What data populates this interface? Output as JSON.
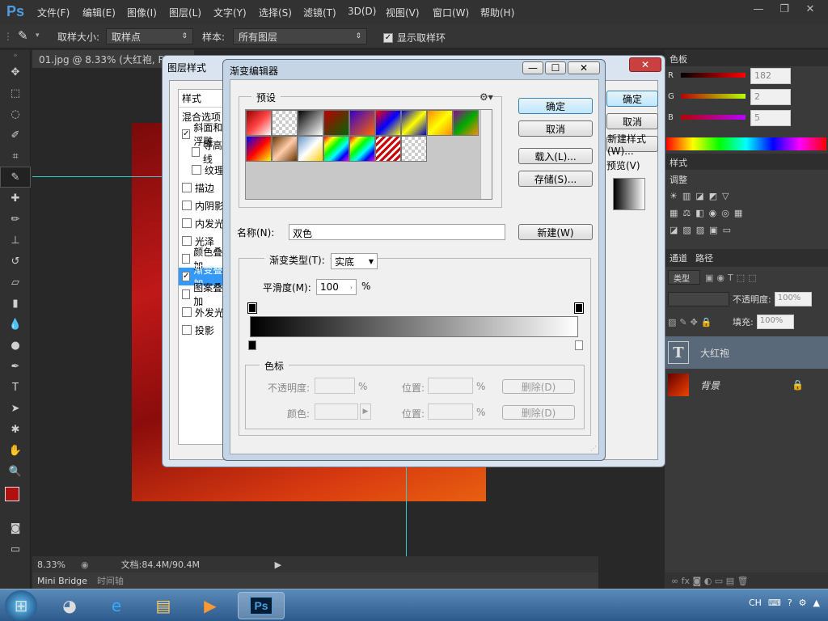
{
  "app": {
    "logo": "Ps"
  },
  "menu": [
    "文件(F)",
    "编辑(E)",
    "图像(I)",
    "图层(L)",
    "文字(Y)",
    "选择(S)",
    "滤镜(T)",
    "3D(D)",
    "视图(V)",
    "窗口(W)",
    "帮助(H)"
  ],
  "options": {
    "sample_size_label": "取样大小:",
    "sample_size_value": "取样点",
    "sample_label": "样本:",
    "sample_value": "所有图层",
    "show_ring_label": "显示取样环"
  },
  "doc_tab": "01.jpg @ 8.33% (大红袍, RG",
  "status": {
    "zoom": "8.33%",
    "doc": "文档:84.4M/90.4M"
  },
  "bottom_tabs": [
    "Mini Bridge",
    "时间轴"
  ],
  "right_panel": {
    "color_tab": "色板",
    "color": {
      "r_label": "R",
      "g_label": "G",
      "b_label": "B",
      "r": "182",
      "g": "2",
      "b": "5"
    },
    "styles_tab": "样式",
    "adjust_label": "调整",
    "channels_tab": "通道",
    "paths_tab": "路径",
    "kind_label": "类型",
    "opacity_label": "不透明度:",
    "opacity": "100%",
    "fill_label": "填充:",
    "fill": "100%",
    "layers": [
      {
        "name": "大红袍"
      },
      {
        "name": "背景"
      }
    ]
  },
  "layer_style": {
    "title": "图层样式",
    "styles_header": "样式",
    "blend_options": "混合选项",
    "items": [
      {
        "label": "斜面和浮雕",
        "checked": true
      },
      {
        "label": "等高线",
        "checked": false
      },
      {
        "label": "纹理",
        "checked": false
      },
      {
        "label": "描边",
        "checked": false
      },
      {
        "label": "内阴影",
        "checked": false
      },
      {
        "label": "内发光",
        "checked": false
      },
      {
        "label": "光泽",
        "checked": false
      },
      {
        "label": "颜色叠加",
        "checked": false
      },
      {
        "label": "渐变叠加",
        "checked": true
      },
      {
        "label": "图案叠加",
        "checked": false
      },
      {
        "label": "外发光",
        "checked": false
      },
      {
        "label": "投影",
        "checked": false
      }
    ],
    "ok_btn": "确定",
    "cancel_btn": "取消",
    "new_style_btn": "新建样式(W)...",
    "preview_label": "预览(V)"
  },
  "gradient_editor": {
    "title": "渐变编辑器",
    "presets_label": "预设",
    "ok_btn": "确定",
    "cancel_btn": "取消",
    "load_btn": "载入(L)...",
    "save_btn": "存储(S)...",
    "name_label": "名称(N):",
    "name_value": "双色",
    "new_btn": "新建(W)",
    "type_label": "渐变类型(T):",
    "type_value": "实底",
    "smooth_label": "平滑度(M):",
    "smooth_value": "100",
    "percent": "%",
    "stops_label": "色标",
    "opacity_label": "不透明度:",
    "color_label": "颜色:",
    "location_label": "位置:",
    "delete_btn": "删除(D)"
  },
  "taskbar": {
    "lang": "CH"
  }
}
